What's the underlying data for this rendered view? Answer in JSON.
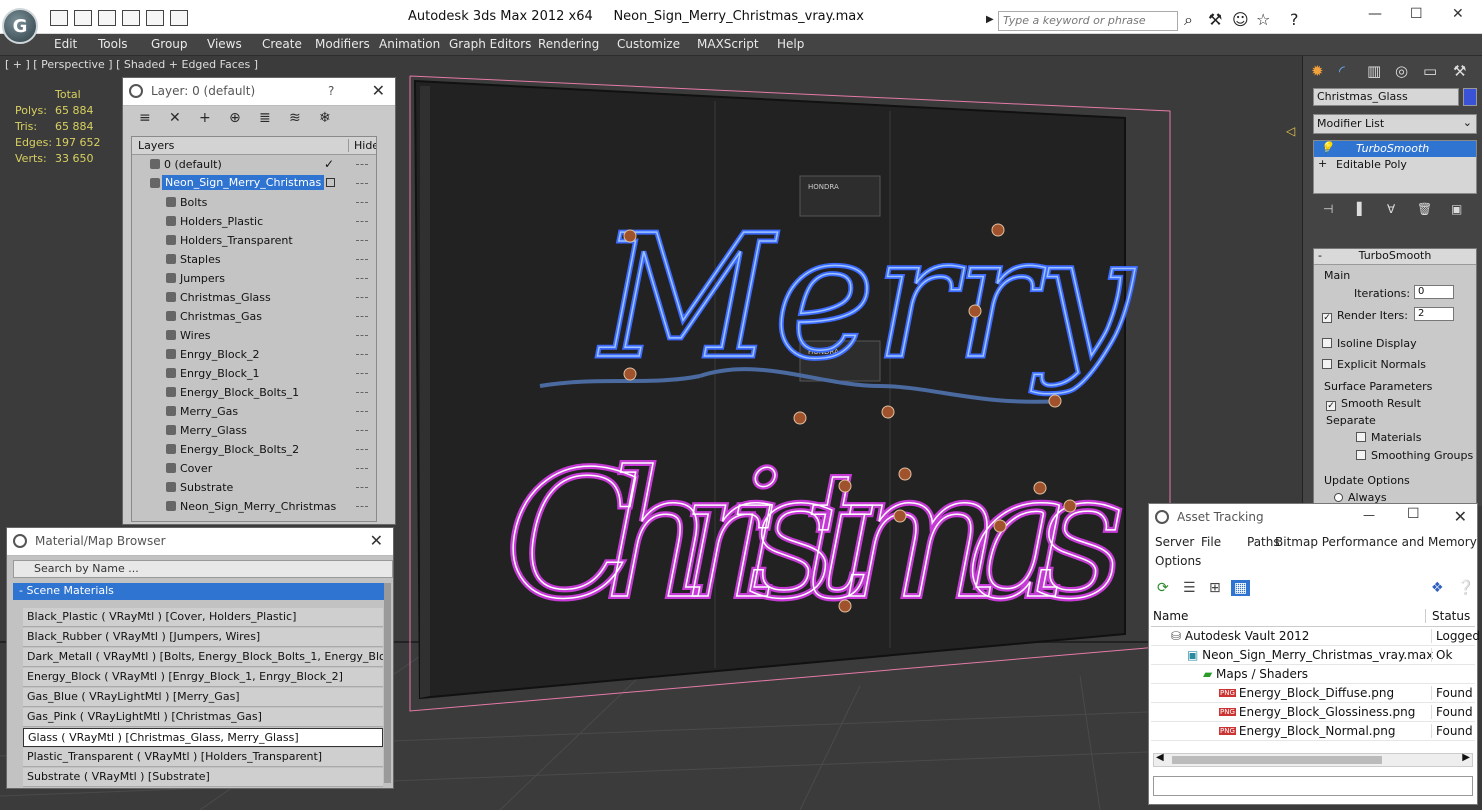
{
  "app": {
    "product": "Autodesk 3ds Max  2012 x64",
    "file": "Neon_Sign_Merry_Christmas_vray.max",
    "logo": "G"
  },
  "search": {
    "placeholder": "Type a keyword or phrase"
  },
  "menus": [
    "Edit",
    "Tools",
    "Group",
    "Views",
    "Create",
    "Modifiers",
    "Animation",
    "Graph Editors",
    "Rendering",
    "Customize",
    "MAXScript",
    "Help"
  ],
  "viewport": {
    "label": "[ + ] [ Perspective ] [ Shaded + Edged Faces ]",
    "stats": {
      "total_label": "Total",
      "rows": [
        {
          "k": "Polys:",
          "v": "65 884"
        },
        {
          "k": "Tris:",
          "v": "65 884"
        },
        {
          "k": "Edges:",
          "v": "197 652"
        },
        {
          "k": "Verts:",
          "v": "33 650"
        }
      ]
    },
    "sign_top": "Merry",
    "sign_bottom": "Christmas",
    "block_label": "HONDRA"
  },
  "layer_panel": {
    "title": "Layer: 0 (default)",
    "help": "?",
    "close": "✕",
    "col_layers": "Layers",
    "col_hide": "Hide",
    "rows": [
      {
        "name": "0 (default)",
        "level": 0,
        "check": "✓"
      },
      {
        "name": "Neon_Sign_Merry_Christmas",
        "level": 0,
        "selected": true
      },
      {
        "name": "Bolts",
        "level": 1
      },
      {
        "name": "Holders_Plastic",
        "level": 1
      },
      {
        "name": "Holders_Transparent",
        "level": 1
      },
      {
        "name": "Staples",
        "level": 1
      },
      {
        "name": "Jumpers",
        "level": 1
      },
      {
        "name": "Christmas_Glass",
        "level": 1
      },
      {
        "name": "Christmas_Gas",
        "level": 1
      },
      {
        "name": "Wires",
        "level": 1
      },
      {
        "name": "Enrgy_Block_2",
        "level": 1
      },
      {
        "name": "Enrgy_Block_1",
        "level": 1
      },
      {
        "name": "Energy_Block_Bolts_1",
        "level": 1
      },
      {
        "name": "Merry_Gas",
        "level": 1
      },
      {
        "name": "Merry_Glass",
        "level": 1
      },
      {
        "name": "Energy_Block_Bolts_2",
        "level": 1
      },
      {
        "name": "Cover",
        "level": 1
      },
      {
        "name": "Substrate",
        "level": 1
      },
      {
        "name": "Neon_Sign_Merry_Christmas",
        "level": 1
      }
    ]
  },
  "material_browser": {
    "title": "Material/Map Browser",
    "close": "✕",
    "search_placeholder": "Search by Name ...",
    "group": "- Scene Materials",
    "items": [
      "Black_Plastic ( VRayMtl ) [Cover, Holders_Plastic]",
      "Black_Rubber ( VRayMtl ) [Jumpers, Wires]",
      "Dark_Metall ( VRayMtl ) [Bolts, Energy_Block_Bolts_1, Energy_Blo...",
      "Energy_Block ( VRayMtl ) [Enrgy_Block_1, Enrgy_Block_2]",
      "Gas_Blue ( VRayLightMtl ) [Merry_Gas]",
      "Gas_Pink ( VRayLightMtl ) [Christmas_Gas]",
      "Glass ( VRayMtl ) [Christmas_Glass, Merry_Glass]",
      "Plastic_Transparent ( VRayMtl ) [Holders_Transparent]",
      "Substrate ( VRayMtl ) [Substrate]"
    ],
    "selected_index": 6
  },
  "command_panel": {
    "object_name": "Christmas_Glass",
    "object_color": "#3a53d6",
    "modifier_list": "Modifier List",
    "stack": [
      {
        "name": "TurboSmooth",
        "selected": true
      },
      {
        "name": "Editable Poly",
        "selected": false
      }
    ],
    "rollout": "TurboSmooth",
    "main": "Main",
    "iterations_label": "Iterations:",
    "iterations": "0",
    "render_iters_label": "Render Iters:",
    "render_iters": "2",
    "isoline": "Isoline Display",
    "explicit_normals": "Explicit Normals",
    "surface": "Surface Parameters",
    "smooth_result": "Smooth Result",
    "separate": "Separate",
    "materials": "Materials",
    "smoothing_groups": "Smoothing Groups",
    "update_options": "Update Options",
    "always": "Always"
  },
  "asset_tracking": {
    "title": "Asset Tracking",
    "menus": [
      "Server",
      "File",
      "Paths",
      "Bitmap Performance and Memory"
    ],
    "options": "Options",
    "col_name": "Name",
    "col_status": "Status",
    "rows": [
      {
        "name": "Autodesk Vault 2012",
        "status": "Logged O",
        "indent": 0
      },
      {
        "name": "Neon_Sign_Merry_Christmas_vray.max",
        "status": "Ok",
        "indent": 1
      },
      {
        "name": "Maps / Shaders",
        "status": "",
        "indent": 2
      },
      {
        "name": "Energy_Block_Diffuse.png",
        "status": "Found",
        "indent": 3
      },
      {
        "name": "Energy_Block_Glossiness.png",
        "status": "Found",
        "indent": 3
      },
      {
        "name": "Energy_Block_Normal.png",
        "status": "Found",
        "indent": 3
      }
    ],
    "png": "PNG"
  }
}
